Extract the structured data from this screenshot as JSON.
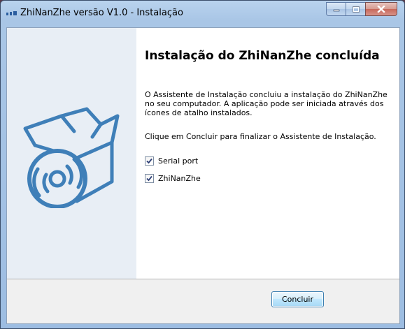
{
  "window": {
    "title": "ZhiNanZhe versão V1.0 - Instalação",
    "app_icon": "installer-app-icon",
    "controls": {
      "minimize_icon": "minimize-icon",
      "maximize_icon": "maximize-icon",
      "close_icon": "close-icon"
    }
  },
  "side_panel": {
    "illustration": "software-box-disc-icon"
  },
  "main": {
    "heading": "Instalação do ZhiNanZhe concluída",
    "paragraph1": "O Assistente de Instalação concluiu a instalação do ZhiNanZhe no seu computador. A aplicação pode ser iniciada através dos ícones de atalho instalados.",
    "paragraph2": "Clique em Concluir para finalizar o Assistente de Instalação.",
    "options": [
      {
        "label": "Serial port",
        "checked": true
      },
      {
        "label": "ZhiNanZhe",
        "checked": true
      }
    ]
  },
  "footer": {
    "finish_label": "Concluir"
  },
  "colors": {
    "side_panel": "#e8eef5",
    "illustration": "#3f7fb8",
    "accent_button_border": "#3c7fb1"
  }
}
